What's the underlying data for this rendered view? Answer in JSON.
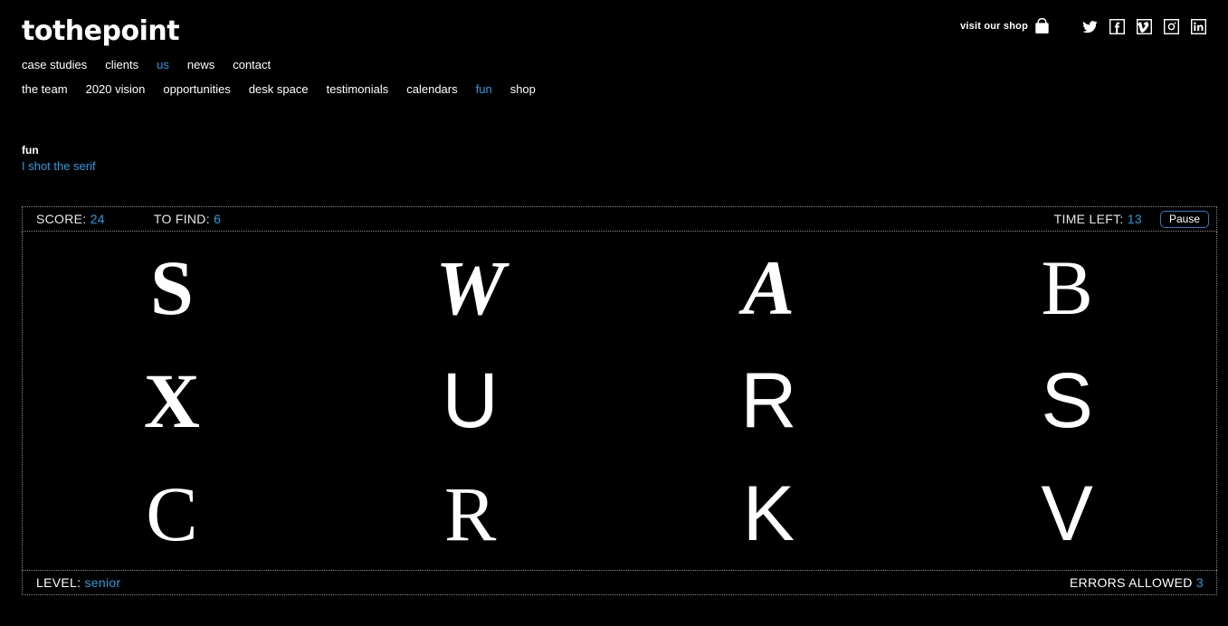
{
  "header": {
    "logo": "tothepoint",
    "shop_link": {
      "label": "visit our shop",
      "icon": "shopping-bag-icon"
    },
    "social": [
      {
        "name": "twitter-icon",
        "label": "Twitter"
      },
      {
        "name": "facebook-icon",
        "label": "Facebook"
      },
      {
        "name": "vimeo-icon",
        "label": "Vimeo"
      },
      {
        "name": "instagram-icon",
        "label": "Instagram"
      },
      {
        "name": "linkedin-icon",
        "label": "LinkedIn"
      }
    ],
    "nav_primary": [
      {
        "label": "case studies",
        "active": false
      },
      {
        "label": "clients",
        "active": false
      },
      {
        "label": "us",
        "active": true
      },
      {
        "label": "news",
        "active": false
      },
      {
        "label": "contact",
        "active": false
      }
    ],
    "nav_secondary": [
      {
        "label": "the team",
        "active": false
      },
      {
        "label": "2020 vision",
        "active": false
      },
      {
        "label": "opportunities",
        "active": false
      },
      {
        "label": "desk space",
        "active": false
      },
      {
        "label": "testimonials",
        "active": false
      },
      {
        "label": "calendars",
        "active": false
      },
      {
        "label": "fun",
        "active": true
      },
      {
        "label": "shop",
        "active": false
      }
    ]
  },
  "page": {
    "kicker": "fun",
    "subtitle": "I shot the serif"
  },
  "game": {
    "status": {
      "score_label": "SCORE:",
      "score_value": "24",
      "tofind_label": "TO FIND:",
      "tofind_value": "6",
      "time_label": "TIME LEFT:",
      "time_value": "13",
      "pause_label": "Pause"
    },
    "grid": {
      "rows": 3,
      "columns": 4,
      "cells": [
        {
          "letter": "S",
          "style": "serif-bold"
        },
        {
          "letter": "W",
          "style": "serif-bold-italic"
        },
        {
          "letter": "A",
          "style": "serif-bold-italic"
        },
        {
          "letter": "B",
          "style": "serif"
        },
        {
          "letter": "X",
          "style": "serif-bold"
        },
        {
          "letter": "U",
          "style": "sans"
        },
        {
          "letter": "R",
          "style": "sans"
        },
        {
          "letter": "S",
          "style": "sans"
        },
        {
          "letter": "C",
          "style": "serif"
        },
        {
          "letter": "R",
          "style": "serif"
        },
        {
          "letter": "K",
          "style": "sans"
        },
        {
          "letter": "V",
          "style": "sans"
        }
      ]
    },
    "footer": {
      "level_label": "LEVEL:",
      "level_value": "senior",
      "errors_label": "ERRORS ALLOWED",
      "errors_value": "3"
    }
  },
  "colors": {
    "background": "#000000",
    "text": "#ffffff",
    "accent": "#1f9fe0",
    "border": "#8a8a8a"
  }
}
